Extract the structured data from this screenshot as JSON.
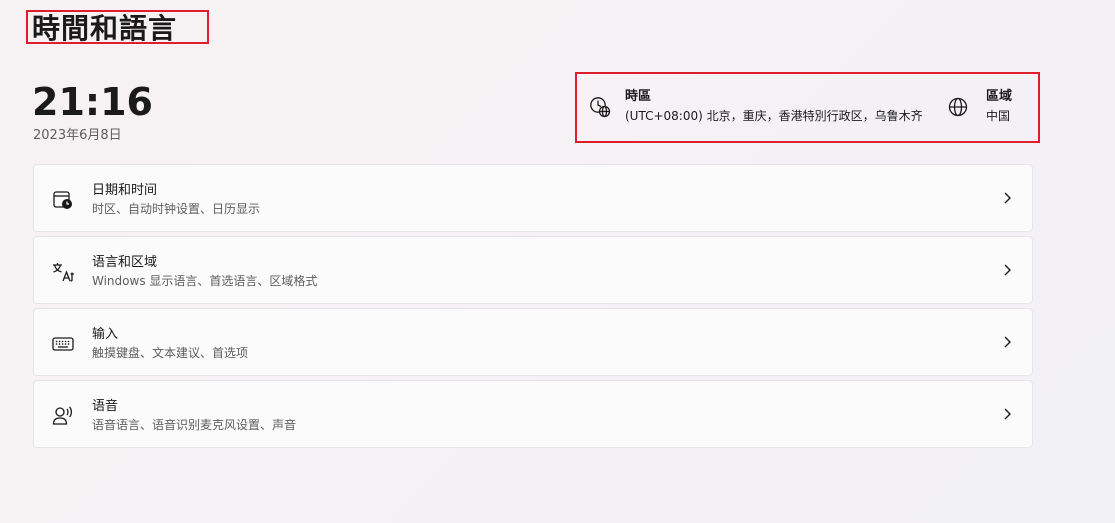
{
  "page": {
    "title": "時間和語言"
  },
  "clock": {
    "time": "21:16",
    "date": "2023年6月8日"
  },
  "quick_settings": [
    {
      "icon": "globe-clock-icon",
      "label": "時區",
      "value": "(UTC+08:00) 北京，重庆，香港特別行政区，乌鲁木齐"
    },
    {
      "icon": "globe-icon",
      "label": "區域",
      "value": "中国"
    }
  ],
  "cards": [
    {
      "icon": "calendar-clock-icon",
      "title": "日期和时间",
      "subtitle": "时区、自动时钟设置、日历显示"
    },
    {
      "icon": "language-icon",
      "title": "语言和区域",
      "subtitle": "Windows 显示语言、首选语言、区域格式"
    },
    {
      "icon": "keyboard-icon",
      "title": "输入",
      "subtitle": "触摸键盘、文本建议、首选项"
    },
    {
      "icon": "speech-icon",
      "title": "语音",
      "subtitle": "语音语言、语音识别麦克风设置、声音"
    }
  ],
  "colors": {
    "highlight_box": "#e01e2b",
    "card_background": "#fbfbfc",
    "secondary_text": "#5d5d5d"
  }
}
